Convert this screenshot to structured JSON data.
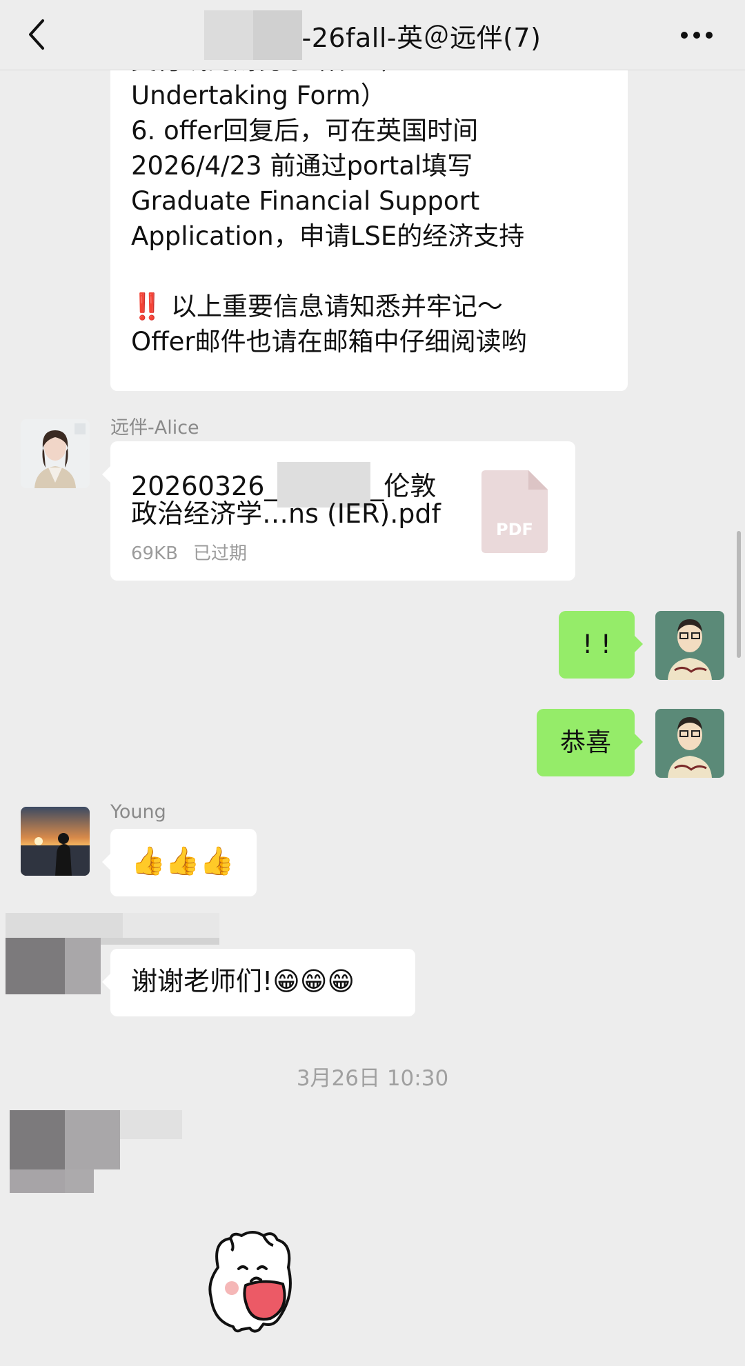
{
  "header": {
    "title_suffix": "-26fall-英＠远伴(7)",
    "back_icon": "chevron-left-icon",
    "more_icon": "more-horizontal-icon"
  },
  "messages": {
    "long_message": {
      "text": "支付线的财务承诺表（Financial\nUndertaking Form）\n6. offer回复后，可在英国时间\n2026/4/23 前通过portal填写\nGraduate Financial Support\nApplication，申请LSE的经济支持\n\n‼️ 以上重要信息请知悉并牢记～\nOffer邮件也请在邮箱中仔细阅读哟"
    },
    "file_message": {
      "sender": "远伴-Alice",
      "name_prefix": "20260326_",
      "name_suffix": "_伦敦",
      "name_line2": "政治经济学…ns (IER).pdf",
      "size": "69KB",
      "status": "已过期",
      "icon_label": "PDF"
    },
    "self_msg_1": {
      "text": "! !"
    },
    "self_msg_2": {
      "text": "恭喜"
    },
    "young_message": {
      "sender": "Young",
      "text": "👍👍👍"
    },
    "thanks_message": {
      "text": "谢谢老师们!😁😁😁"
    },
    "timestamp": "3月26日 10:30"
  },
  "colors": {
    "background": "#ededed",
    "self_bubble": "#95ec69",
    "other_bubble": "#ffffff"
  }
}
